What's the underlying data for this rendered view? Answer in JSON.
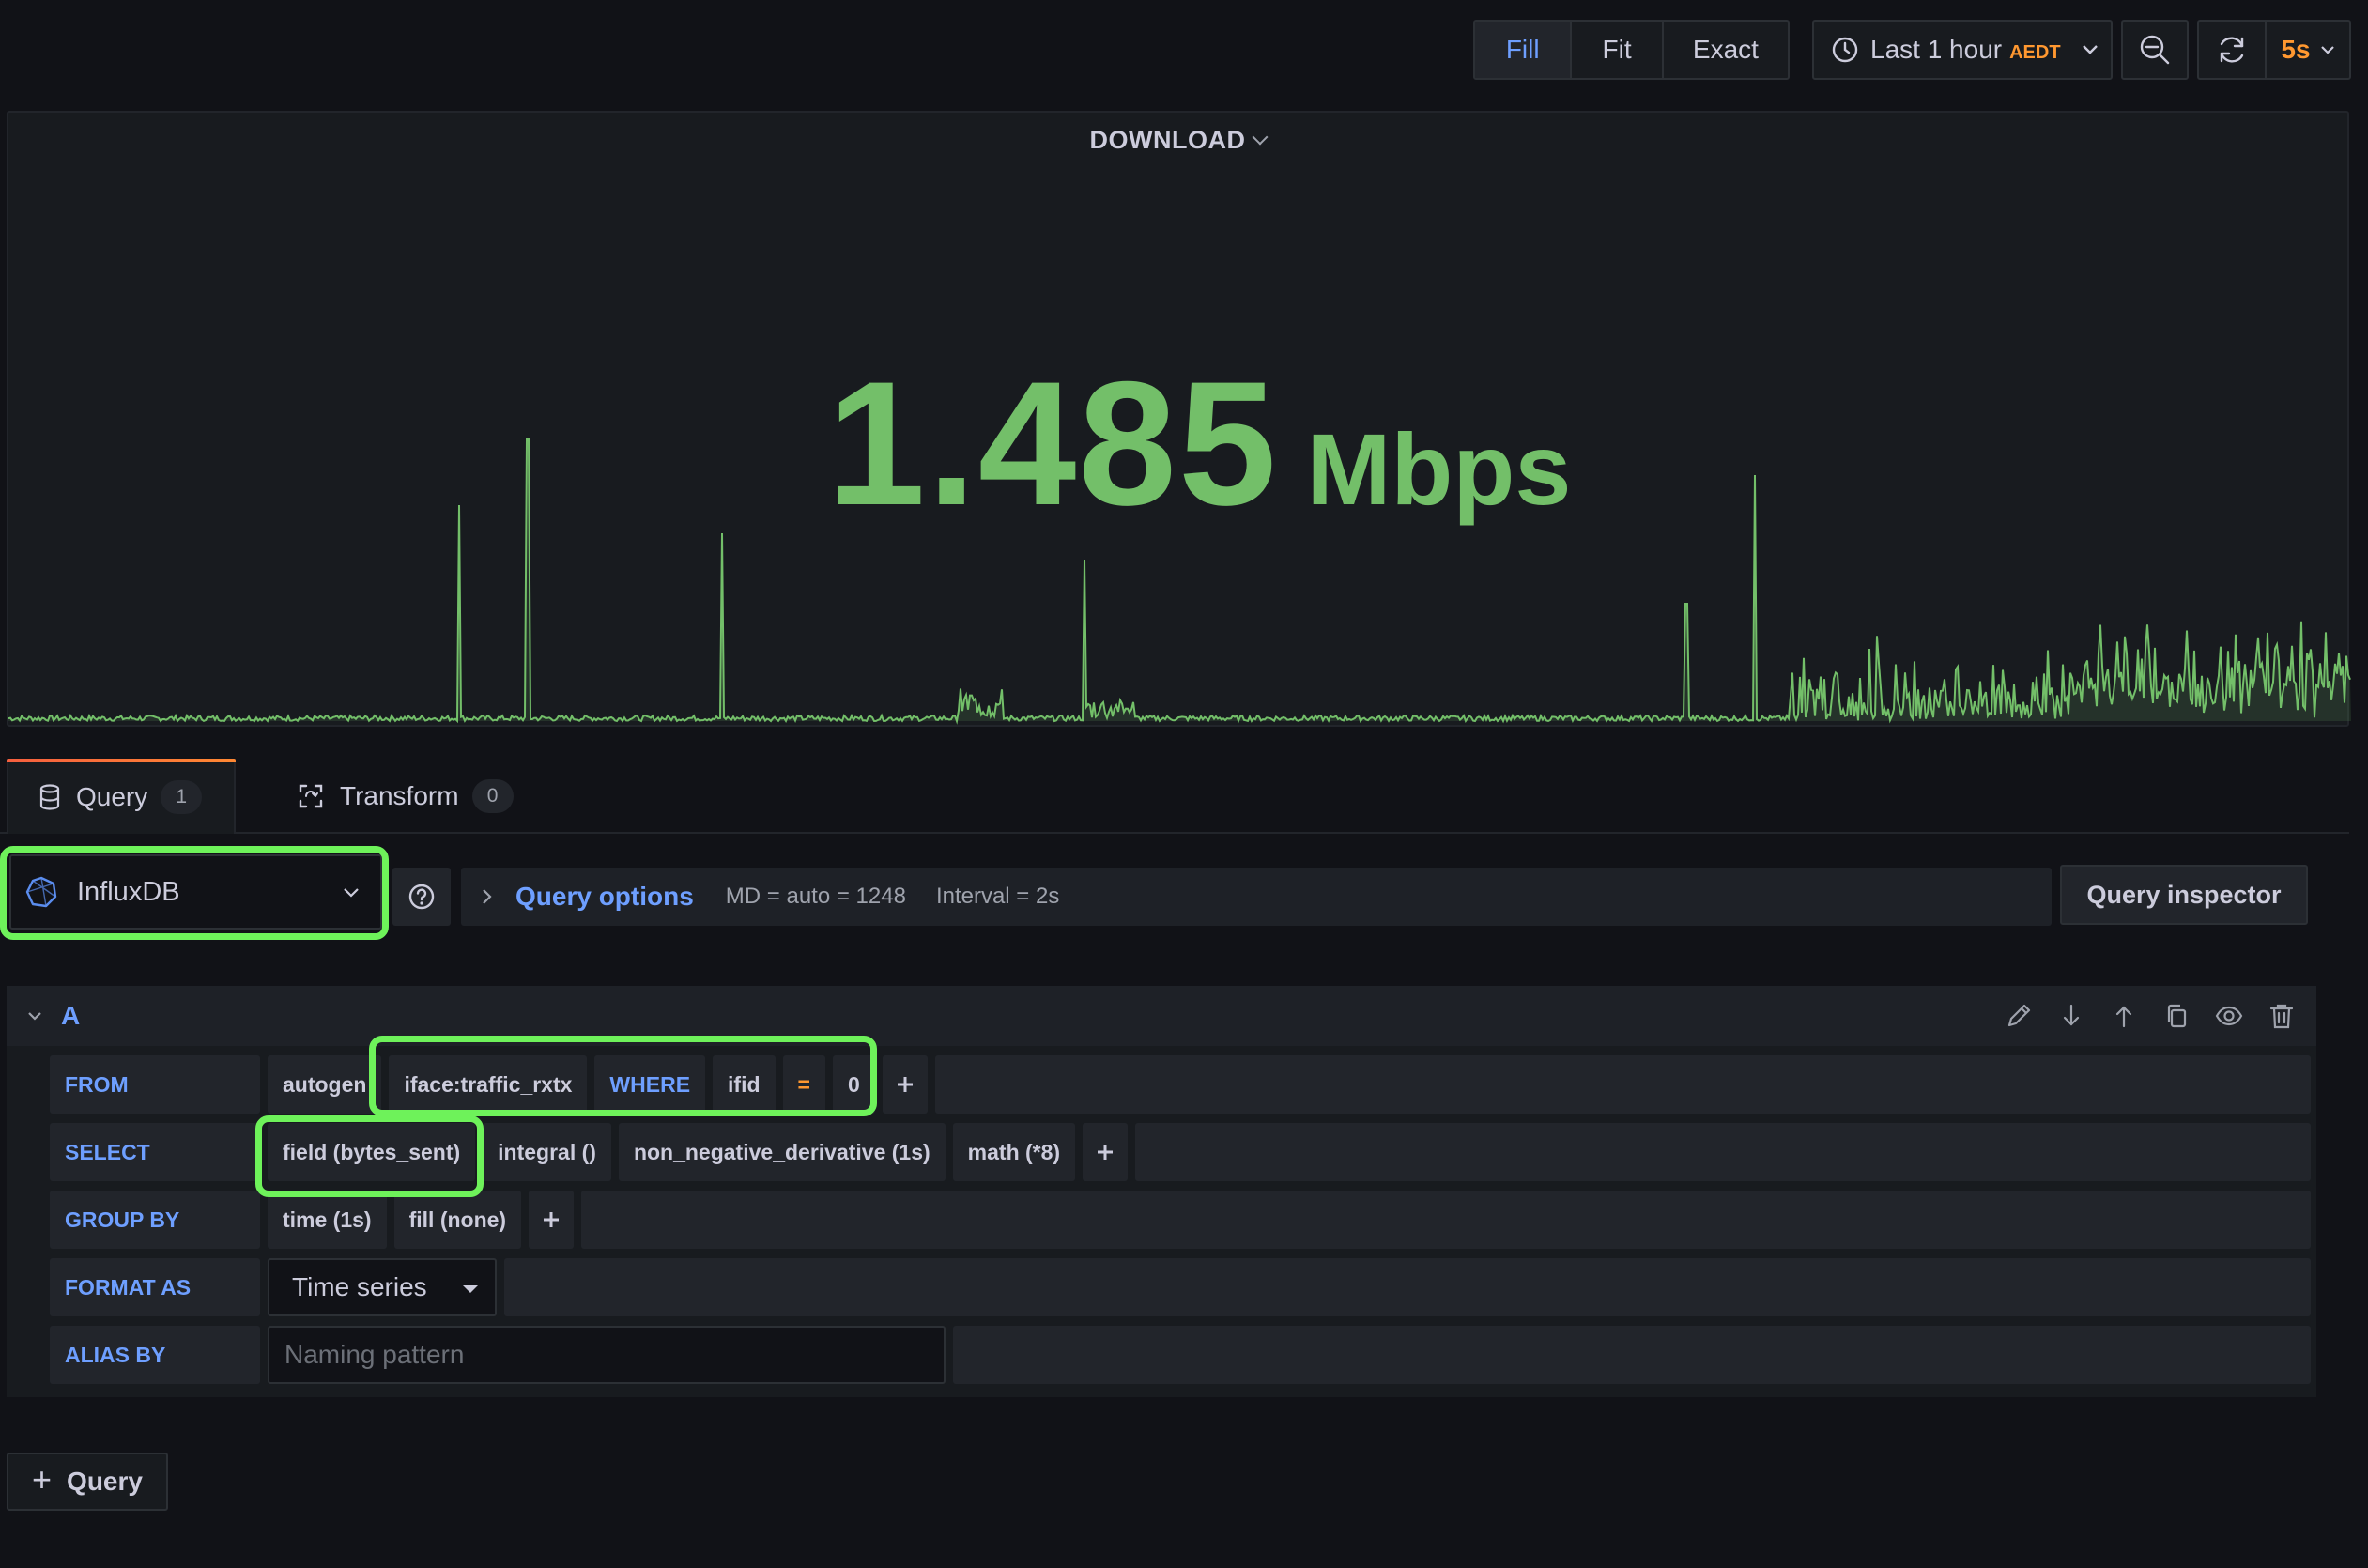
{
  "toolbar": {
    "fit_modes": [
      {
        "label": "Fill",
        "active": true
      },
      {
        "label": "Fit",
        "active": false
      },
      {
        "label": "Exact",
        "active": false
      }
    ],
    "time_range": {
      "label": "Last 1 hour",
      "timezone": "AEDT"
    },
    "refresh_interval": "5s",
    "icons": {
      "clock": "clock-icon",
      "zoom_out": "zoom-out-icon",
      "refresh": "refresh-icon"
    }
  },
  "panel": {
    "title": "DOWNLOAD",
    "stat": {
      "value": "1.485",
      "unit": "Mbps",
      "color": "#73bf69"
    }
  },
  "tabs": [
    {
      "label": "Query",
      "count": "1",
      "active": true
    },
    {
      "label": "Transform",
      "count": "0",
      "active": false
    }
  ],
  "datasource": {
    "name": "InfluxDB"
  },
  "query_options": {
    "title": "Query options",
    "md": "MD = auto = 1248",
    "interval": "Interval = 2s"
  },
  "query_inspector_label": "Query inspector",
  "query": {
    "ref_id": "A",
    "from": {
      "label": "FROM",
      "policy": "autogen",
      "measurement": "iface:traffic_rxtx",
      "where_kw": "WHERE",
      "tag": "ifid",
      "operator": "=",
      "value": "0"
    },
    "select": {
      "label": "SELECT",
      "parts": [
        "field (bytes_sent)",
        "integral ()",
        "non_negative_derivative (1s)",
        "math (*8)"
      ]
    },
    "group_by": {
      "label": "GROUP BY",
      "parts": [
        "time (1s)",
        "fill (none)"
      ]
    },
    "format_as": {
      "label": "FORMAT AS",
      "value": "Time series"
    },
    "alias_by": {
      "label": "ALIAS BY",
      "placeholder": "Naming pattern"
    }
  },
  "add_query_label": "Query",
  "colors": {
    "accent": "#6e9fff",
    "highlight": "#6ef25a",
    "warning": "#ff9830"
  }
}
